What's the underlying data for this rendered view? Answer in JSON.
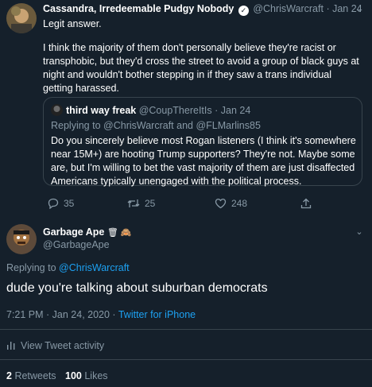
{
  "parent_tweet": {
    "display_name": "Cassandra, Irredeemable Pudgy Nobody",
    "handle": "@ChrisWarcraft",
    "date": "Jan 24",
    "line1": "Legit answer.",
    "line2": "I think the majority of them don't personally believe they're racist or transphobic, but they'd cross the street to avoid a group of black guys at night and wouldn't bother stepping in if they saw a trans individual getting harassed.",
    "quoted": {
      "display_name": "third way freak",
      "handle": "@CoupThereItIs",
      "date": "Jan 24",
      "replying_prefix": "Replying to",
      "replying_to": "@ChrisWarcraft and @FLMarlins85",
      "text": "Do you sincerely believe most Rogan listeners (I think it's somewhere near 15M+) are hooting Trump supporters? They're not. Maybe some are, but I'm willing to bet the vast majority of them are just disaffected Americans typically unengaged with the political process."
    },
    "replies": "35",
    "retweets": "25",
    "likes": "248"
  },
  "main_tweet": {
    "display_name": "Garbage Ape",
    "badges": "🗑 🙈",
    "handle": "@GarbageApe",
    "replying_prefix": "Replying to",
    "replying_to": "@ChrisWarcraft",
    "text": "dude you're talking about suburban democrats",
    "timestamp": "7:21 PM · Jan 24, 2020 ·",
    "source": "Twitter for iPhone",
    "activity_label": "View Tweet activity",
    "retweet_count": "2",
    "retweet_label": "Retweets",
    "like_count": "100",
    "like_label": "Likes"
  },
  "colors": {
    "background": "#15202b",
    "accent": "#1da1f2",
    "muted": "#8899a6",
    "border": "#38444d"
  }
}
